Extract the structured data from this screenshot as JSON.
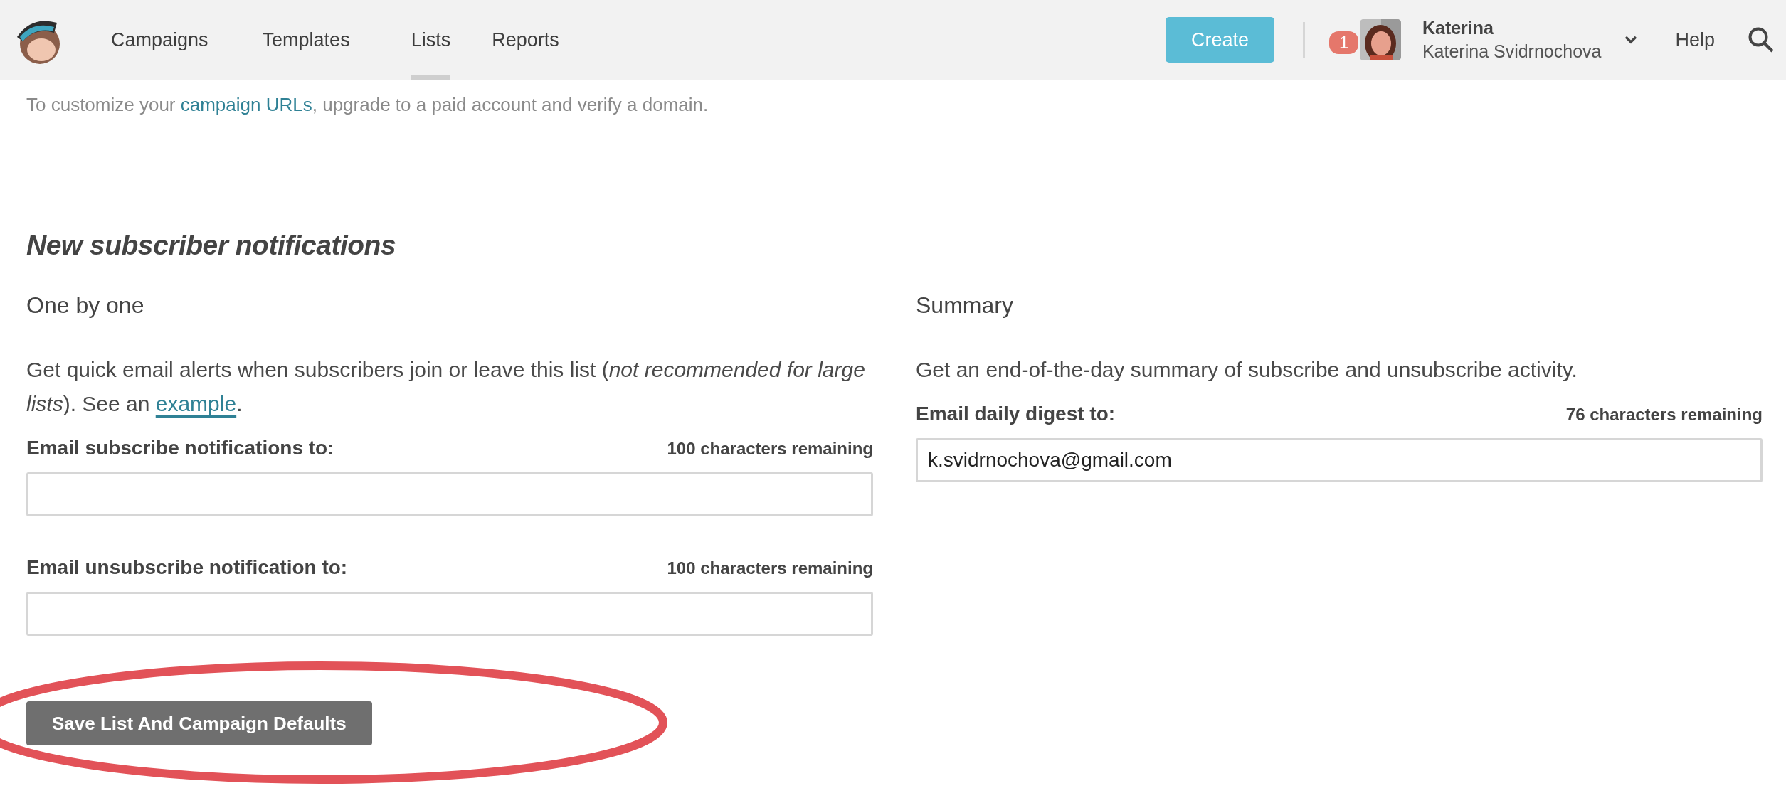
{
  "nav": {
    "tabs": [
      {
        "label": "Campaigns",
        "selected": false
      },
      {
        "label": "Templates",
        "selected": false
      },
      {
        "label": "Lists",
        "selected": true
      },
      {
        "label": "Reports",
        "selected": false
      }
    ],
    "create_button": "Create",
    "notification_count": "1",
    "account": {
      "name": "Katerina",
      "full_name": "Katerina Svidrnochova"
    },
    "help": "Help"
  },
  "url_note": {
    "before": "To customize your ",
    "link": "campaign URLs",
    "after": ", upgrade to a paid account and verify a domain."
  },
  "section_title": "New subscriber notifications",
  "one_by_one": {
    "title": "One by one",
    "description": "Get quick email alerts when subscribers join or leave this list (*not recommended for large lists*). See an ",
    "link": "example",
    "description_end": ".",
    "fields": [
      {
        "label": "Email subscribe notifications to:",
        "counter": "100 characters remaining"
      },
      {
        "label": "Email unsubscribe notification to:",
        "counter": "100 characters remaining"
      }
    ]
  },
  "summary": {
    "title": "Summary",
    "description": "Get an end-of-the-day summary of subscribe and unsubscribe activity.",
    "fields": [
      {
        "label": "Email daily digest to:",
        "counter": "76 characters remaining",
        "value": "k.svidrnochova@gmail.com"
      }
    ]
  },
  "save_button": "Save List And Campaign Defaults"
}
